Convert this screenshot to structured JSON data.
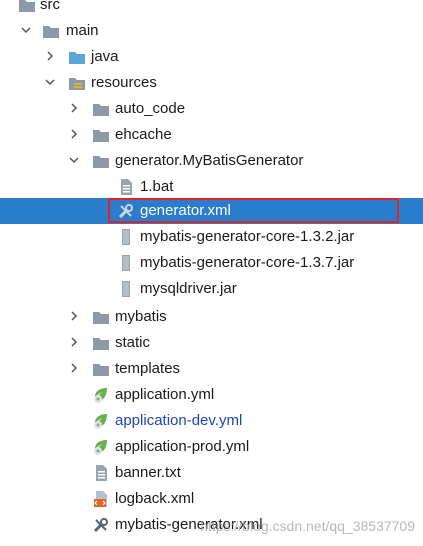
{
  "tree": {
    "src": "src",
    "main": "main",
    "java": "java",
    "resources": "resources",
    "auto_code": "auto_code",
    "ehcache": "ehcache",
    "generator_folder": "generator.MyBatisGenerator",
    "bat": "1.bat",
    "generator_xml": "generator.xml",
    "core_132": "mybatis-generator-core-1.3.2.jar",
    "core_137": "mybatis-generator-core-1.3.7.jar",
    "mysqldriver": "mysqldriver.jar",
    "mybatis": "mybatis",
    "static": "static",
    "templates": "templates",
    "app_yml": "application.yml",
    "app_dev": "application-dev.yml",
    "app_prod": "application-prod.yml",
    "banner": "banner.txt",
    "logback": "logback.xml",
    "mybatis_generator_xml": "mybatis-generator.xml"
  },
  "selected": "generator.xml",
  "colors": {
    "selection": "#2a7ccc",
    "highlight_box": "#e02424",
    "modified_file_text": "#2446a8",
    "folder": "#8c9aa8",
    "java_folder": "#5aa7d6"
  },
  "watermark": "https://blog.csdn.net/qq_38537709"
}
